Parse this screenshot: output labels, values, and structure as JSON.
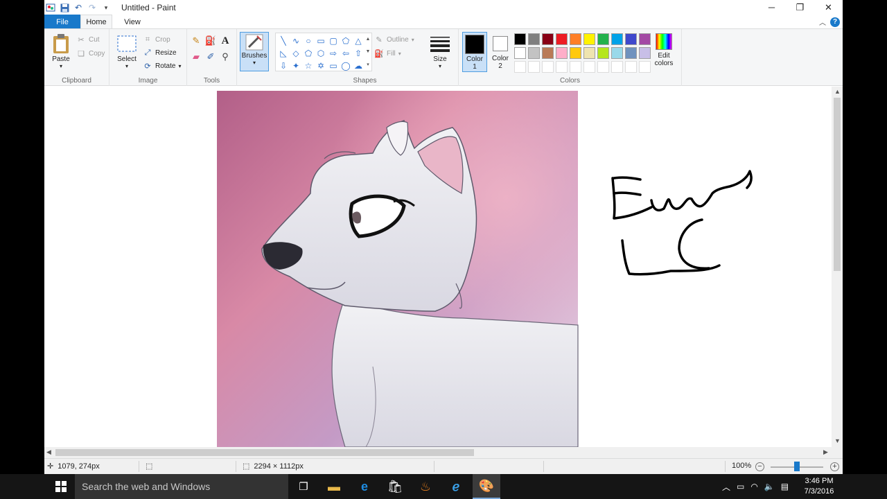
{
  "window": {
    "title": "Untitled - Paint",
    "controls": [
      "minimize",
      "restore",
      "close"
    ]
  },
  "quick_access": [
    "save-icon",
    "undo-icon",
    "redo-icon",
    "customize-icon"
  ],
  "tabs": {
    "file": "File",
    "home": "Home",
    "view": "View"
  },
  "ribbon": {
    "clipboard": {
      "paste": "Paste",
      "cut": "Cut",
      "copy": "Copy",
      "label": "Clipboard"
    },
    "image": {
      "select": "Select",
      "crop": "Crop",
      "resize": "Resize",
      "rotate": "Rotate",
      "label": "Image"
    },
    "tools": {
      "label": "Tools",
      "items": [
        "pencil-icon",
        "fill-icon",
        "text-icon",
        "eraser-icon",
        "color-picker-icon",
        "magnifier-icon"
      ]
    },
    "brushes": {
      "label": "Brushes"
    },
    "shapes": {
      "outline": "Outline",
      "fill": "Fill",
      "label": "Shapes"
    },
    "size": {
      "label": "Size"
    },
    "colors": {
      "color1": {
        "label_line1": "Color",
        "label_line2": "1",
        "value": "#000000"
      },
      "color2": {
        "label_line1": "Color",
        "label_line2": "2",
        "value": "#ffffff"
      },
      "edit_line1": "Edit",
      "edit_line2": "colors",
      "label": "Colors",
      "palette_row1": [
        "#000000",
        "#7f7f7f",
        "#880015",
        "#ed1c24",
        "#ff7f27",
        "#fff200",
        "#22b14c",
        "#00a2e8",
        "#3f48cc",
        "#a349a4"
      ],
      "palette_row2": [
        "#ffffff",
        "#c3c3c3",
        "#b97a57",
        "#ffaec9",
        "#ffc90e",
        "#efe4b0",
        "#b5e61d",
        "#99d9ea",
        "#7092be",
        "#c8bfe7"
      ]
    }
  },
  "status": {
    "cursor_pos": "1079, 274px",
    "image_size": "2294 × 1112px",
    "zoom": "100%"
  },
  "taskbar": {
    "search_placeholder": "Search the web and Windows",
    "apps": [
      "task-view-icon",
      "file-explorer-icon",
      "edge-icon",
      "store-icon",
      "java-icon",
      "internet-explorer-icon",
      "paint-icon"
    ],
    "time": "3:46 PM",
    "date": "7/3/2016"
  }
}
